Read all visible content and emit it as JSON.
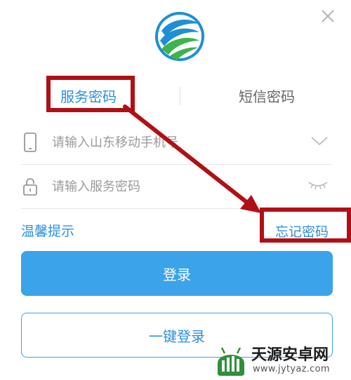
{
  "tabs": {
    "service_password": "服务密码",
    "sms_password": "短信密码"
  },
  "phone_field": {
    "placeholder": "请输入山东移动手机号"
  },
  "password_field": {
    "placeholder": "请输入服务密码"
  },
  "links": {
    "tips": "温馨提示",
    "forgot_password": "忘记密码"
  },
  "buttons": {
    "login": "登录",
    "one_key_login": "一键登录"
  },
  "watermark": {
    "title": "天源安卓网",
    "url": "www.jytyaz.com"
  },
  "icons": {
    "close": "close-icon",
    "logo": "china-mobile-logo",
    "phone": "phone-icon",
    "lock": "lock-icon",
    "dropdown": "chevron-down-icon",
    "eye": "eye-closed-icon"
  },
  "colors": {
    "accent": "#2c8fdc",
    "button": "#3ba3e9",
    "annotation": "#b01015"
  }
}
